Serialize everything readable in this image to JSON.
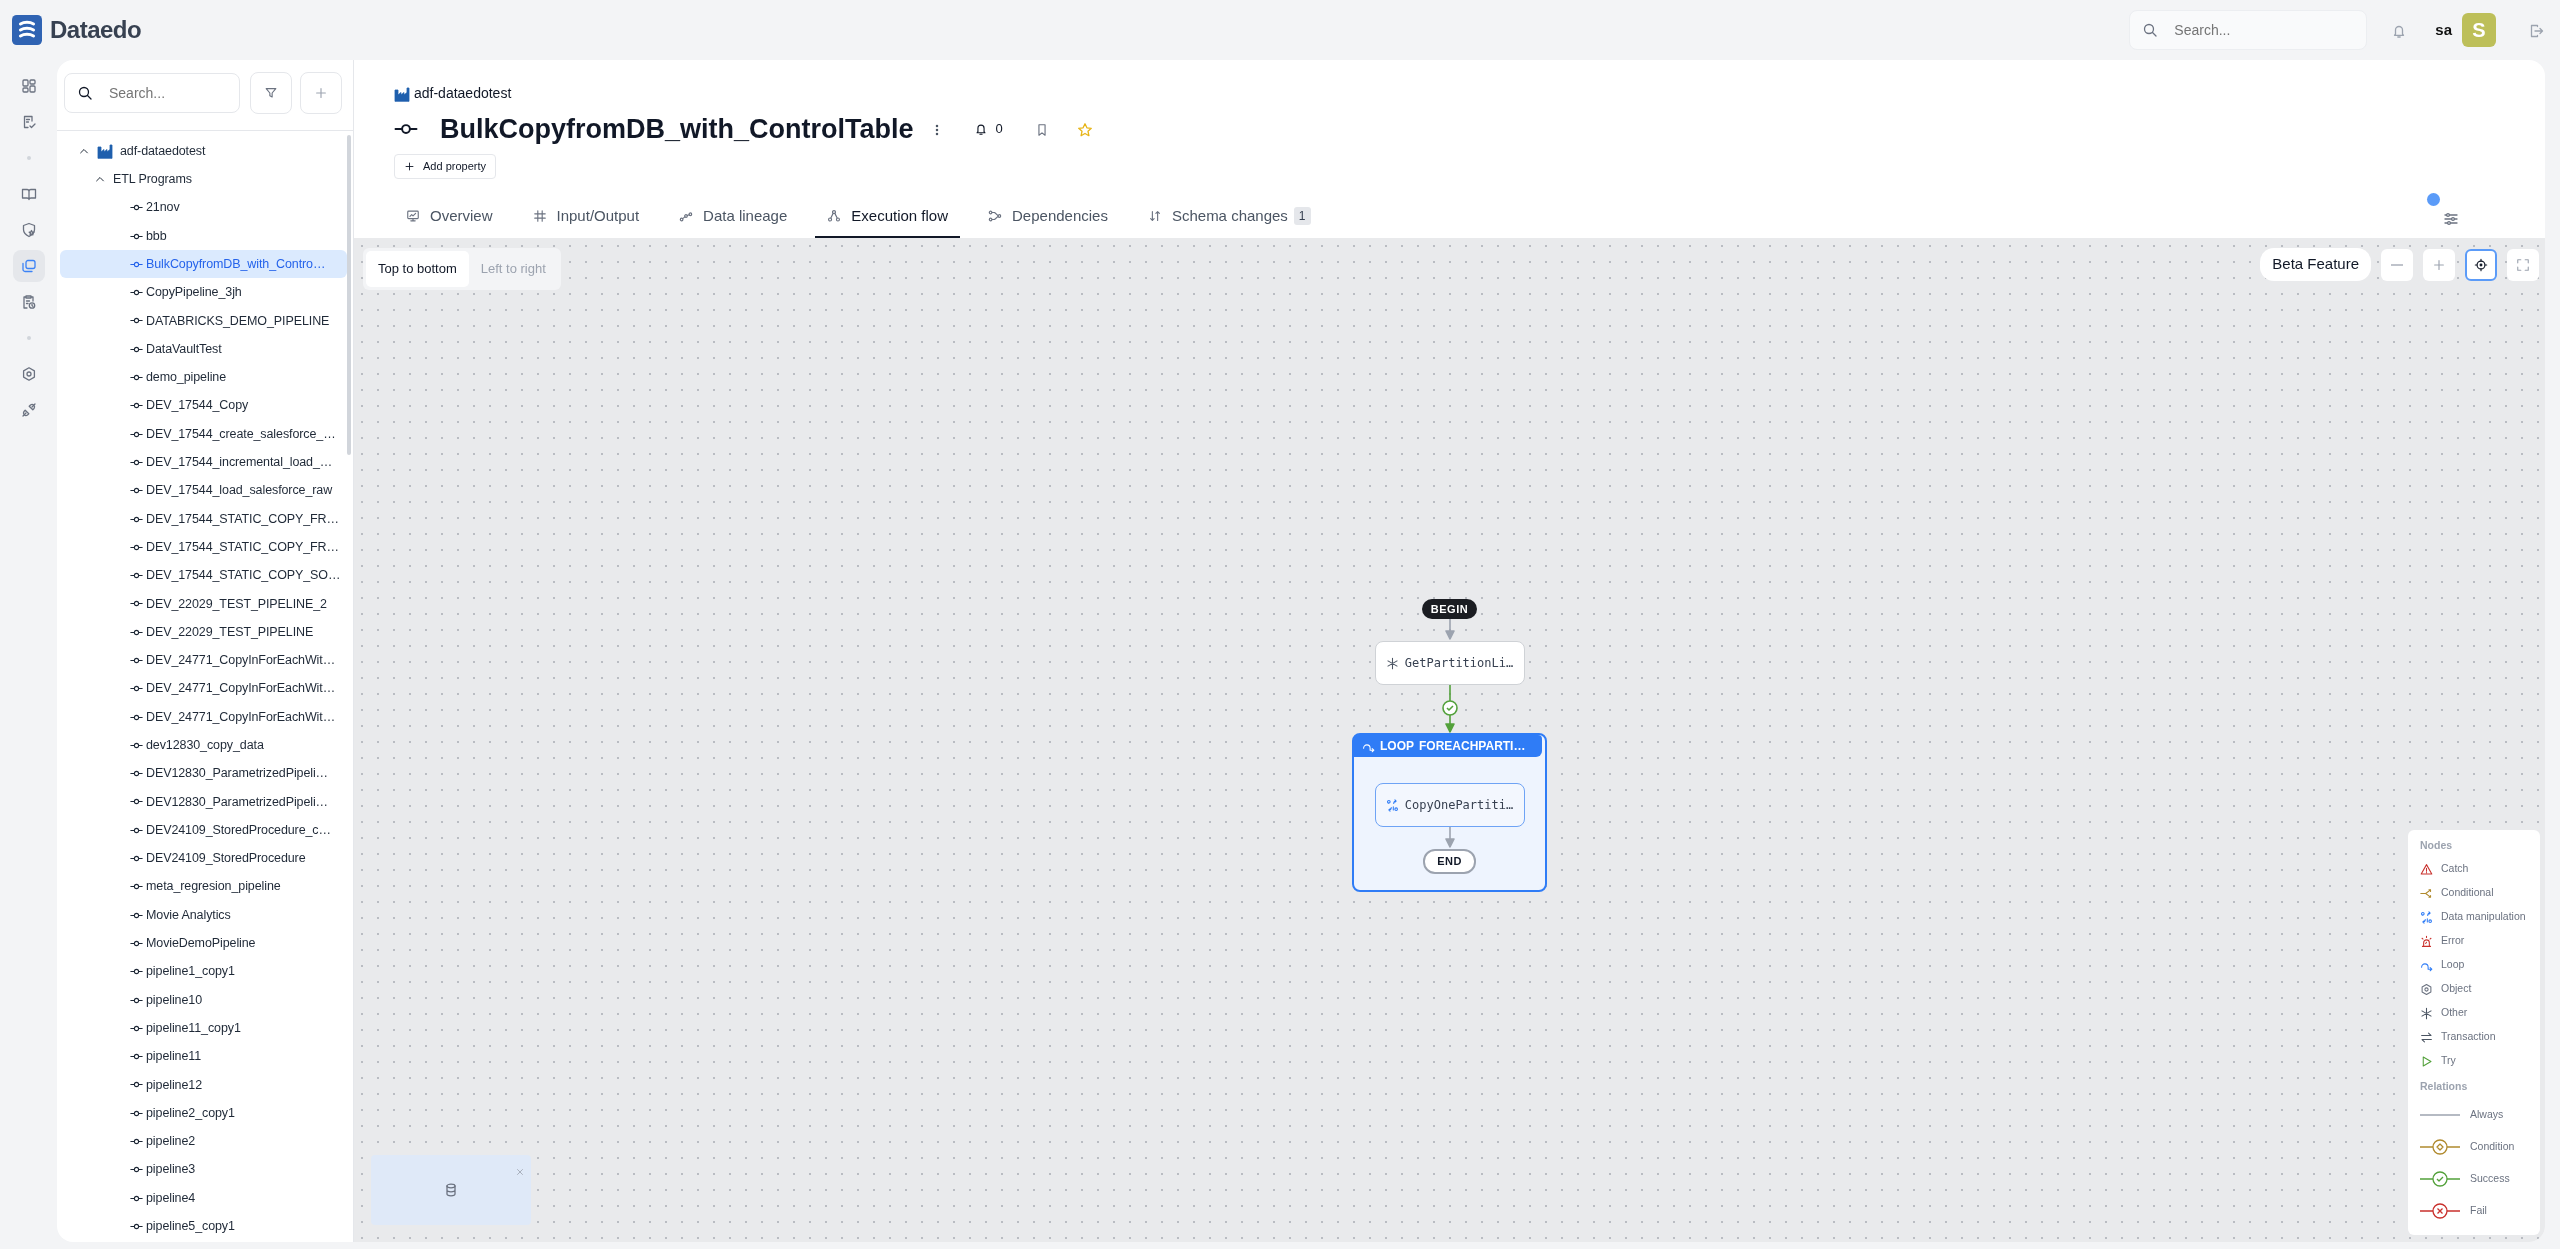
{
  "app": {
    "brand": "Dataedo"
  },
  "topbar": {
    "search": {
      "placeholder": "Search..."
    },
    "user": "sa",
    "avatar": "S"
  },
  "rail": [
    [
      {
        "kind": "dashboard",
        "selected": false
      },
      {
        "kind": "document",
        "selected": false
      }
    ],
    [
      {
        "kind": "book",
        "selected": false
      },
      {
        "kind": "shield",
        "selected": false
      },
      {
        "kind": "objects",
        "selected": true
      },
      {
        "kind": "clipboard",
        "selected": false
      }
    ],
    [
      {
        "kind": "settings",
        "selected": false
      },
      {
        "kind": "connector",
        "selected": false
      }
    ]
  ],
  "sidebar": {
    "search": {
      "placeholder": "Search..."
    },
    "tree": [
      {
        "kind": "source",
        "label": "adf-dataedotest",
        "expanded": true,
        "selected": false,
        "children": [
          {
            "label": "ETL Programs",
            "expanded": true,
            "selected": false,
            "children": [
              {
                "kind": "pipeline",
                "label": "21nov",
                "selected": false
              },
              {
                "kind": "pipeline",
                "label": "bbb",
                "selected": false
              },
              {
                "kind": "pipeline",
                "label": "BulkCopyfromDB_with_Contro…",
                "selected": true
              },
              {
                "kind": "pipeline",
                "label": "CopyPipeline_3jh",
                "selected": false
              },
              {
                "kind": "pipeline",
                "label": "DATABRICKS_DEMO_PIPELINE",
                "selected": false
              },
              {
                "kind": "pipeline",
                "label": "DataVaultTest",
                "selected": false
              },
              {
                "kind": "pipeline",
                "label": "demo_pipeline",
                "selected": false
              },
              {
                "kind": "pipeline",
                "label": "DEV_17544_Copy",
                "selected": false
              },
              {
                "kind": "pipeline",
                "label": "DEV_17544_create_salesforce_…",
                "selected": false
              },
              {
                "kind": "pipeline",
                "label": "DEV_17544_incremental_load_…",
                "selected": false
              },
              {
                "kind": "pipeline",
                "label": "DEV_17544_load_salesforce_raw",
                "selected": false
              },
              {
                "kind": "pipeline",
                "label": "DEV_17544_STATIC_COPY_FR…",
                "selected": false
              },
              {
                "kind": "pipeline",
                "label": "DEV_17544_STATIC_COPY_FR…",
                "selected": false
              },
              {
                "kind": "pipeline",
                "label": "DEV_17544_STATIC_COPY_SO…",
                "selected": false
              },
              {
                "kind": "pipeline",
                "label": "DEV_22029_TEST_PIPELINE_2",
                "selected": false
              },
              {
                "kind": "pipeline",
                "label": "DEV_22029_TEST_PIPELINE",
                "selected": false
              },
              {
                "kind": "pipeline",
                "label": "DEV_24771_CopyInForEachWit…",
                "selected": false
              },
              {
                "kind": "pipeline",
                "label": "DEV_24771_CopyInForEachWit…",
                "selected": false
              },
              {
                "kind": "pipeline",
                "label": "DEV_24771_CopyInForEachWit…",
                "selected": false
              },
              {
                "kind": "pipeline",
                "label": "dev12830_copy_data",
                "selected": false
              },
              {
                "kind": "pipeline",
                "label": "DEV12830_ParametrizedPipeli…",
                "selected": false
              },
              {
                "kind": "pipeline",
                "label": "DEV12830_ParametrizedPipeli…",
                "selected": false
              },
              {
                "kind": "pipeline",
                "label": "DEV24109_StoredProcedure_c…",
                "selected": false
              },
              {
                "kind": "pipeline",
                "label": "DEV24109_StoredProcedure",
                "selected": false
              },
              {
                "kind": "pipeline",
                "label": "meta_regresion_pipeline",
                "selected": false
              },
              {
                "kind": "pipeline",
                "label": "Movie Analytics",
                "selected": false
              },
              {
                "kind": "pipeline",
                "label": "MovieDemoPipeline",
                "selected": false
              },
              {
                "kind": "pipeline",
                "label": "pipeline1_copy1",
                "selected": false
              },
              {
                "kind": "pipeline",
                "label": "pipeline10",
                "selected": false
              },
              {
                "kind": "pipeline",
                "label": "pipeline11_copy1",
                "selected": false
              },
              {
                "kind": "pipeline",
                "label": "pipeline11",
                "selected": false
              },
              {
                "kind": "pipeline",
                "label": "pipeline12",
                "selected": false
              },
              {
                "kind": "pipeline",
                "label": "pipeline2_copy1",
                "selected": false
              },
              {
                "kind": "pipeline",
                "label": "pipeline2",
                "selected": false
              },
              {
                "kind": "pipeline",
                "label": "pipeline3",
                "selected": false
              },
              {
                "kind": "pipeline",
                "label": "pipeline4",
                "selected": false
              },
              {
                "kind": "pipeline",
                "label": "pipeline5_copy1",
                "selected": false
              }
            ]
          }
        ]
      }
    ]
  },
  "header": {
    "breadcrumb": "adf-dataedotest",
    "title": "BulkCopyfromDB_with_ControlTable",
    "notifications": "0",
    "add_property": "Add property",
    "tabs": [
      {
        "kind": "overview",
        "label": "Overview",
        "selected": false
      },
      {
        "kind": "input_output",
        "label": "Input/Output",
        "selected": false
      },
      {
        "kind": "lineage",
        "label": "Data lineage",
        "selected": false
      },
      {
        "kind": "execution",
        "label": "Execution flow",
        "selected": true
      },
      {
        "kind": "dependencies",
        "label": "Dependencies",
        "selected": false
      },
      {
        "kind": "schema",
        "label": "Schema changes",
        "count": "1",
        "selected": false
      }
    ],
    "settings_indicator": true
  },
  "canvas": {
    "orientation": [
      {
        "label": "Top to bottom",
        "selected": true
      },
      {
        "label": "Left to right",
        "selected": false
      }
    ],
    "beta_label": "Beta Feature",
    "controls": [
      {
        "kind": "zoom_out",
        "focused": false
      },
      {
        "kind": "zoom_in",
        "focused": false
      },
      {
        "kind": "fit",
        "focused": true
      },
      {
        "kind": "fullscreen",
        "focused": false
      }
    ],
    "flow": {
      "begin": "BEGIN",
      "nodes": [
        {
          "kind": "other",
          "label": "GetPartitionLi…",
          "incoming": {
            "kind": "always"
          }
        },
        {
          "kind": "loop",
          "keyword": "LOOP",
          "label": "FOREACHPARTI…",
          "incoming": {
            "kind": "success"
          },
          "children": [
            {
              "kind": "data_manipulation",
              "label": "CopyOnePartiti…"
            }
          ],
          "end": {
            "label": "END",
            "incoming": {
              "kind": "always"
            }
          }
        }
      ]
    },
    "legend": {
      "nodes_title": "Nodes",
      "nodes": [
        {
          "kind": "catch",
          "label": "Catch"
        },
        {
          "kind": "conditional",
          "label": "Conditional"
        },
        {
          "kind": "data_manipulation",
          "label": "Data manipulation"
        },
        {
          "kind": "error",
          "label": "Error"
        },
        {
          "kind": "loop",
          "label": "Loop"
        },
        {
          "kind": "object",
          "label": "Object"
        },
        {
          "kind": "other",
          "label": "Other"
        },
        {
          "kind": "transaction",
          "label": "Transaction"
        },
        {
          "kind": "try",
          "label": "Try"
        }
      ],
      "relations_title": "Relations",
      "relations": [
        {
          "kind": "always",
          "label": "Always"
        },
        {
          "kind": "condition",
          "label": "Condition"
        },
        {
          "kind": "success",
          "label": "Success"
        },
        {
          "kind": "fail",
          "label": "Fail"
        }
      ]
    }
  }
}
